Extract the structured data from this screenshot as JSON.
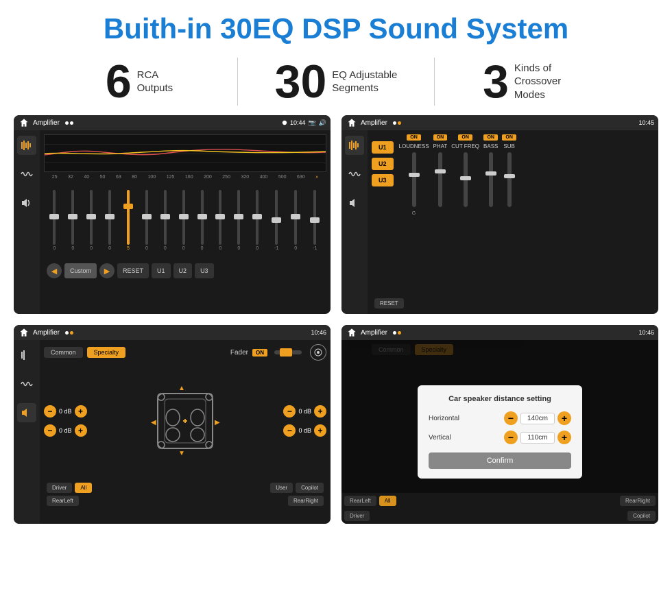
{
  "header": {
    "title": "Buith-in 30EQ DSP Sound System"
  },
  "stats": [
    {
      "number": "6",
      "label": "RCA\nOutputs"
    },
    {
      "number": "30",
      "label": "EQ Adjustable\nSegments"
    },
    {
      "number": "3",
      "label": "Kinds of\nCrossover Modes"
    }
  ],
  "screens": [
    {
      "id": "eq-screen",
      "statusTitle": "Amplifier",
      "statusTime": "10:44",
      "type": "equalizer"
    },
    {
      "id": "crossover-screen",
      "statusTitle": "Amplifier",
      "statusTime": "10:45",
      "type": "crossover"
    },
    {
      "id": "fader-screen",
      "statusTitle": "Amplifier",
      "statusTime": "10:46",
      "type": "fader"
    },
    {
      "id": "distance-screen",
      "statusTitle": "Amplifier",
      "statusTime": "10:46",
      "type": "distance"
    }
  ],
  "eq": {
    "freqLabels": [
      "25",
      "32",
      "40",
      "50",
      "63",
      "80",
      "100",
      "125",
      "160",
      "200",
      "250",
      "320",
      "400",
      "500",
      "630"
    ],
    "sliderValues": [
      "0",
      "0",
      "0",
      "0",
      "5",
      "0",
      "0",
      "0",
      "0",
      "0",
      "0",
      "0",
      "-1",
      "0",
      "-1"
    ],
    "presetLabel": "Custom",
    "buttons": [
      "RESET",
      "U1",
      "U2",
      "U3"
    ]
  },
  "crossover": {
    "channels": [
      "LOUDNESS",
      "PHAT",
      "CUT FREQ",
      "BASS",
      "SUB"
    ],
    "uButtons": [
      "U1",
      "U2",
      "U3"
    ],
    "resetLabel": "RESET"
  },
  "fader": {
    "tabs": [
      "Common",
      "Specialty"
    ],
    "faderLabel": "Fader",
    "onLabel": "ON",
    "volGroups": [
      {
        "label": "0 dB"
      },
      {
        "label": "0 dB"
      },
      {
        "label": "0 dB"
      },
      {
        "label": "0 dB"
      }
    ],
    "bottomBtns": [
      "Driver",
      "All",
      "User",
      "RearLeft",
      "Copilot",
      "RearRight"
    ]
  },
  "dialog": {
    "title": "Car speaker distance setting",
    "fields": [
      {
        "label": "Horizontal",
        "value": "140cm"
      },
      {
        "label": "Vertical",
        "value": "110cm"
      }
    ],
    "confirmLabel": "Confirm"
  },
  "colors": {
    "accent": "#f0a020",
    "blue": "#1a7fd4",
    "dark": "#1a1a1a"
  }
}
